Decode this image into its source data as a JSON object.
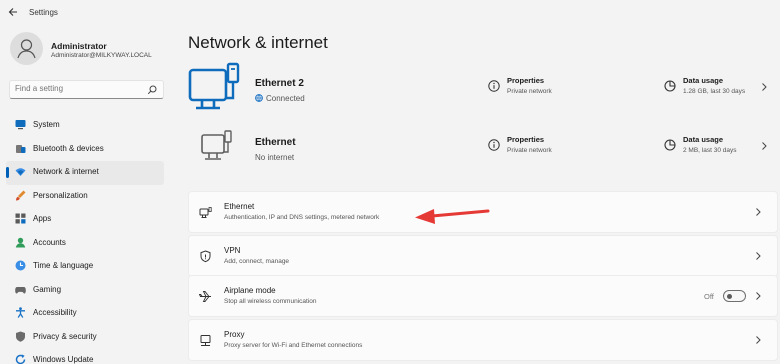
{
  "window": {
    "title": "Settings"
  },
  "user": {
    "name": "Administrator",
    "email": "Administrator@MILKYWAY.LOCAL"
  },
  "search": {
    "placeholder": "Find a setting"
  },
  "nav": [
    {
      "label": "System",
      "icon": "monitor-icon",
      "active": false
    },
    {
      "label": "Bluetooth & devices",
      "icon": "bluetooth-icon",
      "active": false
    },
    {
      "label": "Network & internet",
      "icon": "wifi-icon",
      "active": true
    },
    {
      "label": "Personalization",
      "icon": "brush-icon",
      "active": false
    },
    {
      "label": "Apps",
      "icon": "apps-icon",
      "active": false
    },
    {
      "label": "Accounts",
      "icon": "person-icon",
      "active": false
    },
    {
      "label": "Time & language",
      "icon": "globe-clock-icon",
      "active": false
    },
    {
      "label": "Gaming",
      "icon": "gamepad-icon",
      "active": false
    },
    {
      "label": "Accessibility",
      "icon": "accessibility-icon",
      "active": false
    },
    {
      "label": "Privacy & security",
      "icon": "shield-icon",
      "active": false
    },
    {
      "label": "Windows Update",
      "icon": "update-icon",
      "active": false
    }
  ],
  "page": {
    "title": "Network & internet"
  },
  "adapters": [
    {
      "name": "Ethernet 2",
      "status": "Connected",
      "connected": true,
      "properties_label": "Properties",
      "properties_sub": "Private network",
      "usage_label": "Data usage",
      "usage_sub": "1.28 GB, last 30 days"
    },
    {
      "name": "Ethernet",
      "status": "No internet",
      "connected": false,
      "properties_label": "Properties",
      "properties_sub": "Private network",
      "usage_label": "Data usage",
      "usage_sub": "2 MB, last 30 days"
    }
  ],
  "settings": [
    {
      "title": "Ethernet",
      "subtitle": "Authentication, IP and DNS settings, metered network",
      "icon": "ethernet-icon"
    },
    {
      "title": "VPN",
      "subtitle": "Add, connect, manage",
      "icon": "vpn-shield-icon"
    },
    {
      "title": "Airplane mode",
      "subtitle": "Stop all wireless communication",
      "icon": "airplane-icon",
      "toggle_label": "Off",
      "toggle_on": false
    },
    {
      "title": "Proxy",
      "subtitle": "Proxy server for Wi-Fi and Ethernet connections",
      "icon": "proxy-icon"
    }
  ],
  "colors": {
    "accent": "#005fb8",
    "adapter_blue": "#0f6cbd",
    "arrow": "#e53935"
  }
}
